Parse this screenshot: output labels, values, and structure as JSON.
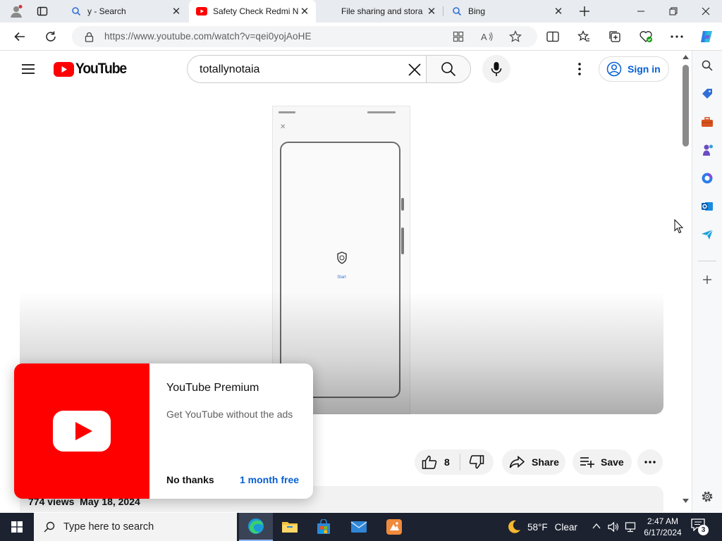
{
  "browser": {
    "tabs": [
      {
        "title": "y - Search",
        "icon": "search-icon",
        "active": false
      },
      {
        "title": "Safety Check Redmi N",
        "icon": "youtube-icon",
        "active": true
      },
      {
        "title": "File sharing and stora",
        "icon": "none",
        "active": false
      },
      {
        "title": "Bing",
        "icon": "search-icon",
        "active": false
      }
    ],
    "url": "https://www.youtube.com/watch?v=qei0yojAoHE"
  },
  "youtube": {
    "logo_text": "YouTube",
    "search_value": "totallynotaia",
    "signin_label": "Sign in",
    "phone_screen_label": "Start",
    "likes": "8",
    "share_label": "Share",
    "save_label": "Save",
    "views_date": "774 views  May 18, 2024"
  },
  "premium_popup": {
    "title": "YouTube Premium",
    "description": "Get YouTube without the ads",
    "dismiss_label": "No thanks",
    "accept_label": "1 month free"
  },
  "taskbar": {
    "search_placeholder": "Type here to search",
    "temperature": "58°F",
    "condition": "Clear",
    "time": "2:47 AM",
    "date": "6/17/2024",
    "notification_count": "3"
  },
  "colors": {
    "youtube_red": "#ff0000",
    "link_blue": "#065fd4",
    "taskbar_bg": "#1c2230"
  }
}
